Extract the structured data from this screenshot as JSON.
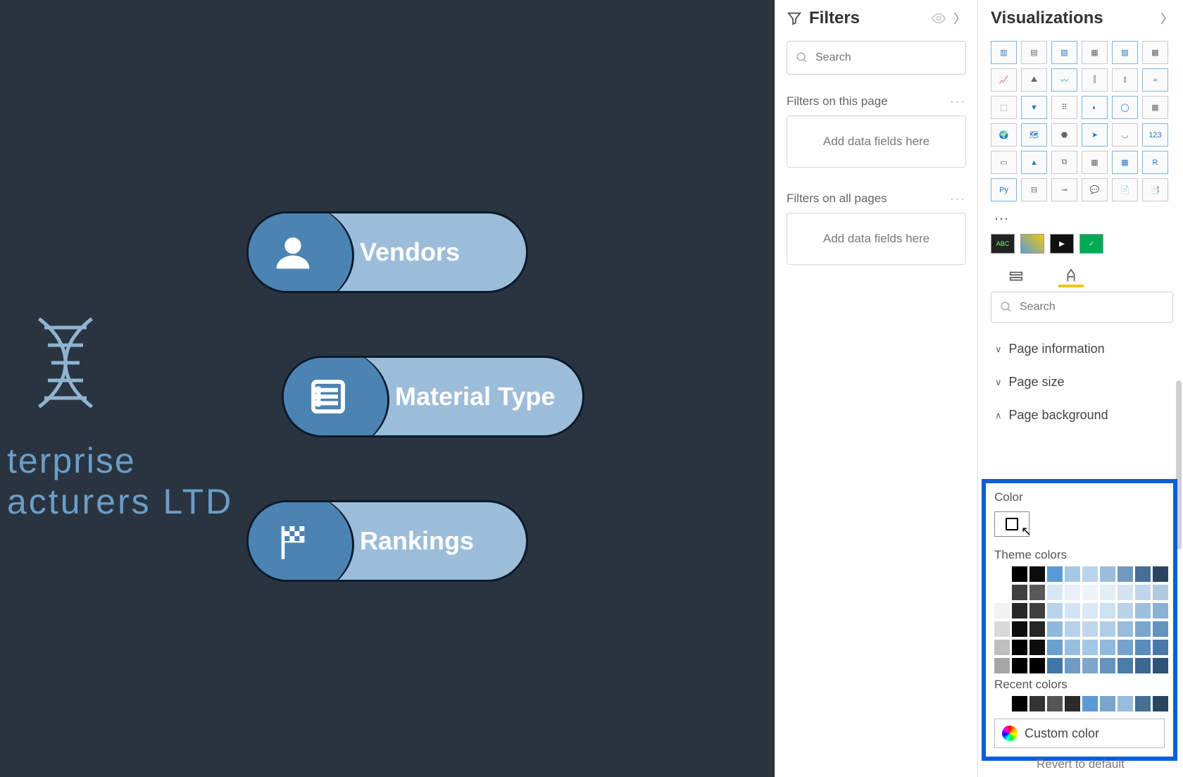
{
  "canvas": {
    "brand_line1": "terprise",
    "brand_line2": "acturers LTD",
    "buttons": [
      {
        "label": "Vendors"
      },
      {
        "label": "Material Type"
      },
      {
        "label": "Rankings"
      }
    ]
  },
  "filters": {
    "title": "Filters",
    "search_placeholder": "Search",
    "section_page_label": "Filters on this page",
    "section_all_label": "Filters on all pages",
    "dropzone_text": "Add data fields here"
  },
  "viz": {
    "title": "Visualizations",
    "search_placeholder": "Search",
    "ellipsis": "…",
    "accordion": [
      {
        "label": "Page information",
        "open": false
      },
      {
        "label": "Page size",
        "open": false
      },
      {
        "label": "Page background",
        "open": true
      }
    ],
    "picker": {
      "label": "Color",
      "theme_label": "Theme colors",
      "recent_label": "Recent colors",
      "custom_label": "Custom color",
      "theme_head": [
        "#ffffff",
        "#000000",
        "#0d0d0d",
        "#5b9bd5",
        "#a5c8e4",
        "#b9d3ea",
        "#9cbdd9",
        "#7199bd",
        "#476f94",
        "#2b4560"
      ],
      "theme_grid": [
        [
          "#ffffff",
          "#404040",
          "#595959",
          "#d6e7f5",
          "#e8f1fa",
          "#ecf4fb",
          "#e3eef7",
          "#d4e3f0",
          "#c2d5e8",
          "#b3c9e0"
        ],
        [
          "#f2f2f2",
          "#262626",
          "#3f3f3f",
          "#b8d3ea",
          "#d2e4f3",
          "#d9e9f5",
          "#cde1f0",
          "#b9d2e8",
          "#9fc0dd",
          "#8cb1d3"
        ],
        [
          "#d9d9d9",
          "#0d0d0d",
          "#262626",
          "#8fb9db",
          "#b6d1e9",
          "#bfd8ed",
          "#afcde6",
          "#97bcdc",
          "#7aa6cd",
          "#6493be"
        ],
        [
          "#bfbfbf",
          "#000000",
          "#0d0d0d",
          "#6aa0cd",
          "#99bfe0",
          "#a4c7e3",
          "#90b9da",
          "#76a3cb",
          "#5a8bba",
          "#4878a8"
        ],
        [
          "#a6a6a6",
          "#000000",
          "#000000",
          "#3f77a6",
          "#6f9cc6",
          "#7da6cc",
          "#6394bf",
          "#4a7daa",
          "#3a6890",
          "#2c5378"
        ]
      ],
      "recent": [
        "#ffffff",
        "#000000",
        "#333333",
        "#555555",
        "#2b2b2b",
        "#5b9bd5",
        "#7aa6cd",
        "#97bcdc",
        "#476f94",
        "#2b4560"
      ]
    },
    "revert_label": "Revert to default"
  }
}
